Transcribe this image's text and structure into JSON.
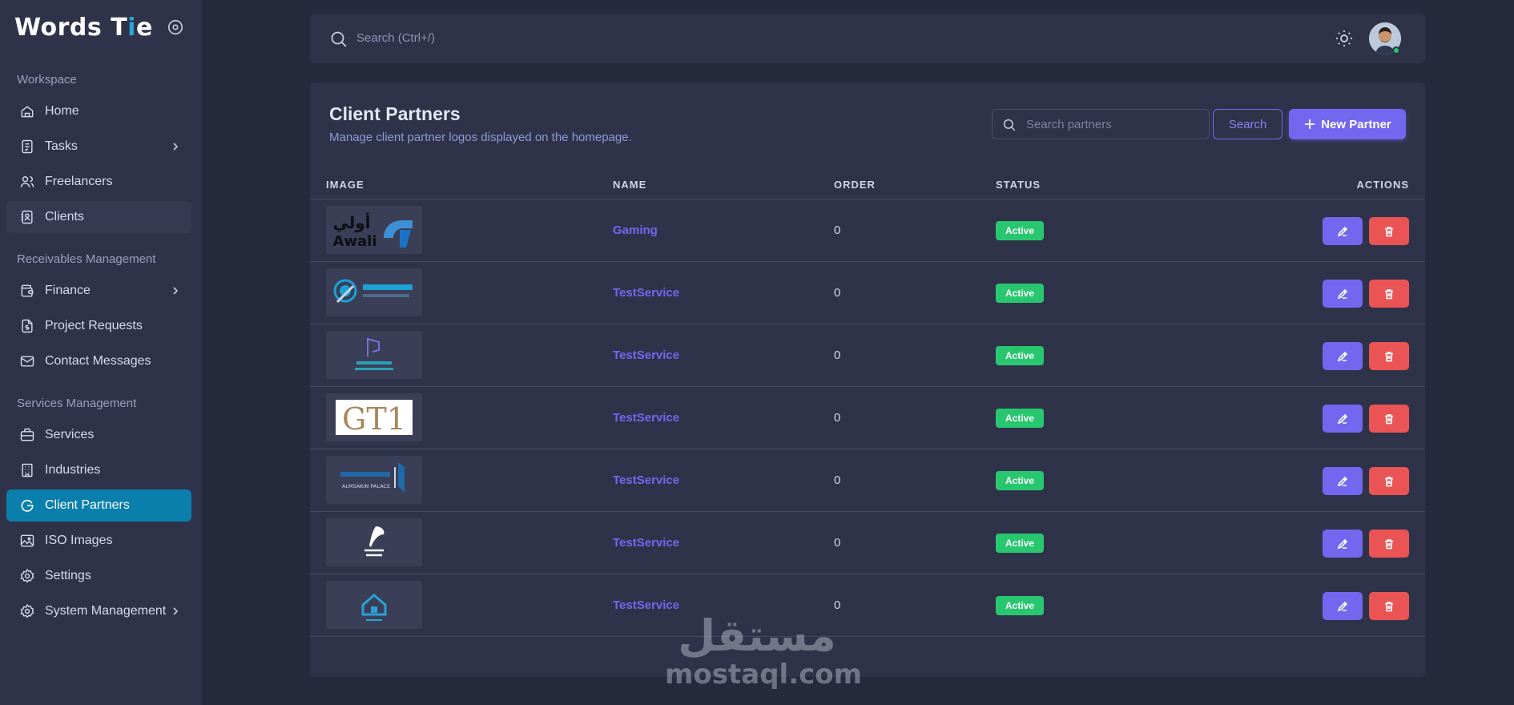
{
  "brand": {
    "name_main": "Words T",
    "name_accent": "i",
    "name_end": "e"
  },
  "sidebar": {
    "sections": [
      {
        "title": "Workspace"
      },
      {
        "title": "Receivables Management"
      },
      {
        "title": "Services Management"
      }
    ],
    "items": [
      {
        "label": "Home",
        "icon": "home-icon"
      },
      {
        "label": "Tasks",
        "icon": "tasks-icon",
        "has_children": true
      },
      {
        "label": "Freelancers",
        "icon": "users-icon"
      },
      {
        "label": "Clients",
        "icon": "clients-icon"
      },
      {
        "label": "Finance",
        "icon": "wallet-icon",
        "has_children": true
      },
      {
        "label": "Project Requests",
        "icon": "invoice-icon"
      },
      {
        "label": "Contact Messages",
        "icon": "mail-icon"
      },
      {
        "label": "Services",
        "icon": "briefcase-icon"
      },
      {
        "label": "Industries",
        "icon": "building-icon"
      },
      {
        "label": "Client Partners",
        "icon": "brand-g-icon",
        "active": true
      },
      {
        "label": "ISO Images",
        "icon": "image-icon"
      },
      {
        "label": "Settings",
        "icon": "settings-icon"
      },
      {
        "label": "System Management",
        "icon": "settings-icon",
        "has_children": true
      }
    ]
  },
  "topbar": {
    "search_placeholder": "Search (Ctrl+/)"
  },
  "card": {
    "title": "Client Partners",
    "subtitle": "Manage client partner logos displayed on the homepage.",
    "search_placeholder": "Search partners",
    "search_button": "Search",
    "new_button": "New Partner"
  },
  "table": {
    "headers": [
      "IMAGE",
      "NAME",
      "ORDER",
      "STATUS",
      "ACTIONS"
    ],
    "rows": [
      {
        "logo": "awali-logo",
        "logo_text_ar": "أولي",
        "logo_text": "Awali",
        "name": "Gaming",
        "order": "0",
        "status": "Active"
      },
      {
        "logo": "network-logo",
        "name": "TestService",
        "order": "0",
        "status": "Active"
      },
      {
        "logo": "realestate-logo",
        "name": "TestService",
        "order": "0",
        "status": "Active"
      },
      {
        "logo": "gt1-logo",
        "logo_text": "GT1",
        "name": "TestService",
        "order": "0",
        "status": "Active"
      },
      {
        "logo": "palace-logo",
        "logo_text": "ALMSAKIN PALACE",
        "name": "TestService",
        "order": "0",
        "status": "Active"
      },
      {
        "logo": "quill-logo",
        "name": "TestService",
        "order": "0",
        "status": "Active"
      },
      {
        "logo": "home-shield-logo",
        "name": "TestService",
        "order": "0",
        "status": "Active"
      }
    ]
  },
  "watermark": {
    "text_ar": "مستقل",
    "text": "mostaql.com"
  },
  "colors": {
    "primary": "#7367f0",
    "active_nav": "#0b7fac",
    "success": "#28c76f",
    "danger": "#ea5455",
    "surface": "#2f3349",
    "background": "#252a3d"
  }
}
